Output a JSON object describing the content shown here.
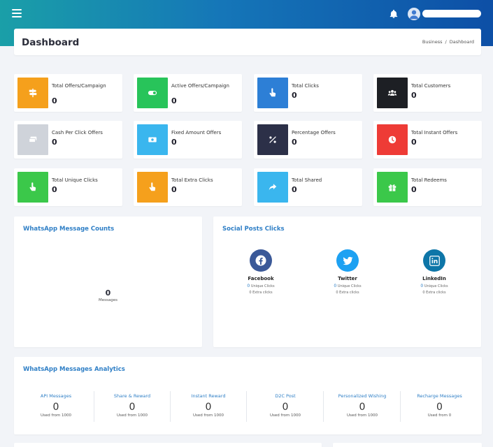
{
  "header": {
    "page_title": "Dashboard"
  },
  "breadcrumb": [
    "Business",
    "Dashboard"
  ],
  "stats": [
    {
      "label": "Total Offers/Campaign",
      "value": "0",
      "color": "#f5a01c",
      "icon": "signpost-icon"
    },
    {
      "label": "Active Offers/Campaign",
      "value": "0",
      "color": "#28c45a",
      "icon": "toggle-icon"
    },
    {
      "label": "Total Clicks",
      "value": "0",
      "color": "#2d7fd6",
      "icon": "pointer-hand-icon"
    },
    {
      "label": "Total Customers",
      "value": "0",
      "color": "#1d1f24",
      "icon": "users-icon"
    },
    {
      "label": "Cash Per Click Offers",
      "value": "0",
      "color": "#cfd3da",
      "icon": "cash-stack-icon"
    },
    {
      "label": "Fixed Amount Offers",
      "value": "0",
      "color": "#3ab6ee",
      "icon": "banknote-icon"
    },
    {
      "label": "Percentage Offers",
      "value": "0",
      "color": "#2c3048",
      "icon": "percent-icon"
    },
    {
      "label": "Total Instant Offers",
      "value": "0",
      "color": "#ee3b36",
      "icon": "clock-icon"
    },
    {
      "label": "Total Unique Clicks",
      "value": "0",
      "color": "#3bc84a",
      "icon": "pointer-hand-icon"
    },
    {
      "label": "Total Extra Clicks",
      "value": "0",
      "color": "#f5a01c",
      "icon": "pointer-hand-icon"
    },
    {
      "label": "Total Shared",
      "value": "0",
      "color": "#3ab6ee",
      "icon": "share-icon"
    },
    {
      "label": "Total Redeems",
      "value": "0",
      "color": "#3bc84a",
      "icon": "gift-icon"
    }
  ],
  "whatsapp_counts": {
    "title": "WhatsApp Message Counts",
    "value": "0",
    "label": "Messages"
  },
  "social_posts": {
    "title": "Social Posts Clicks",
    "items": [
      {
        "name": "Facebook",
        "color": "#3b5998",
        "unique": "0",
        "unique_label": "Unique Clicks",
        "extra": "0",
        "extra_label": "Extra clicks",
        "icon": "facebook-icon"
      },
      {
        "name": "Twitter",
        "color": "#1da1f2",
        "unique": "0",
        "unique_label": "Unique Clicks",
        "extra": "0",
        "extra_label": "Extra clicks",
        "icon": "twitter-icon"
      },
      {
        "name": "LinkedIn",
        "color": "#0e76a8",
        "unique": "0",
        "unique_label": "Unique Clicks",
        "extra": "0",
        "extra_label": "Extra clicks",
        "icon": "linkedin-icon"
      }
    ]
  },
  "analytics": {
    "title": "WhatsApp Messages Analytics",
    "columns": [
      {
        "label": "API Messages",
        "value": "0",
        "sub": "Used from 1000"
      },
      {
        "label": "Share & Reward",
        "value": "0",
        "sub": "Used from 1000"
      },
      {
        "label": "Instant Reward",
        "value": "0",
        "sub": "Used from 1000"
      },
      {
        "label": "D2C Post",
        "value": "0",
        "sub": "Used from 1000"
      },
      {
        "label": "Personalized Wishing",
        "value": "0",
        "sub": "Used from 1000"
      },
      {
        "label": "Recharge Messages",
        "value": "0",
        "sub": "Used from 0"
      }
    ]
  }
}
